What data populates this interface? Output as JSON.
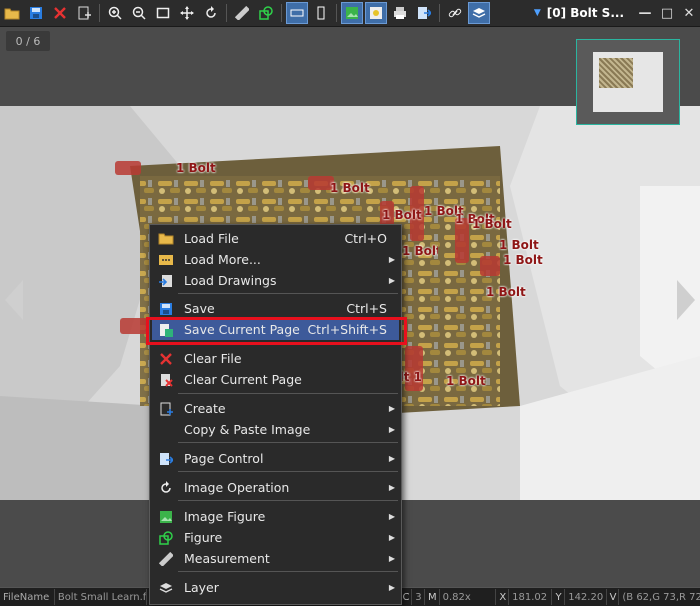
{
  "window": {
    "title": "[0] Bolt S...",
    "controls": [
      "—",
      "□",
      "✕"
    ]
  },
  "viewer": {
    "page_counter": "0 / 6"
  },
  "annotations": [
    {
      "text": "1 Bolt"
    },
    {
      "text": "1 Bolt"
    },
    {
      "text": "1 Bolt"
    },
    {
      "text": "1 Bolt"
    },
    {
      "text": "1 Bolt"
    },
    {
      "text": "1 Bolt"
    },
    {
      "text": "1 Bolt"
    },
    {
      "text": "1 Bolt"
    },
    {
      "text": "1 Bolt"
    },
    {
      "text": "1 Bolt"
    },
    {
      "text": "1 Bolt"
    },
    {
      "text": "1 Bolt"
    }
  ],
  "context_menu": {
    "items": [
      {
        "label": "Load File",
        "shortcut": "Ctrl+O",
        "icon": "folder-icon"
      },
      {
        "label": "Load More...",
        "submenu": true,
        "icon": "load-more-icon"
      },
      {
        "label": "Load Drawings",
        "submenu": true,
        "icon": "load-drawings-icon"
      },
      {
        "label": "Save",
        "shortcut": "Ctrl+S",
        "icon": "save-icon"
      },
      {
        "label": "Save Current Page",
        "shortcut": "Ctrl+Shift+S",
        "icon": "save-page-icon",
        "highlighted": true
      },
      {
        "label": "Clear File",
        "icon": "clear-file-icon"
      },
      {
        "label": "Clear Current Page",
        "icon": "clear-page-icon"
      },
      {
        "label": "Create",
        "submenu": true,
        "icon": "create-icon"
      },
      {
        "label": "Copy & Paste Image",
        "submenu": true
      },
      {
        "label": "Page Control",
        "submenu": true,
        "icon": "page-control-icon"
      },
      {
        "label": "Image Operation",
        "submenu": true,
        "icon": "image-operation-icon"
      },
      {
        "label": "Image Figure",
        "submenu": true,
        "icon": "image-figure-icon"
      },
      {
        "label": "Figure",
        "submenu": true,
        "icon": "figure-icon"
      },
      {
        "label": "Measurement",
        "submenu": true,
        "icon": "measurement-icon"
      },
      {
        "label": "Layer",
        "submenu": true,
        "icon": "layer-icon"
      }
    ]
  },
  "statusbar": {
    "filename_label": "FileName",
    "filename_value": "Bolt Small Learn.f",
    "c_label": "C",
    "c_value": "3",
    "m_label": "M",
    "m_value": "0.82x",
    "x_label": "X",
    "x_value": "181.02",
    "y_label": "Y",
    "y_value": "142.20",
    "v_label": "V",
    "v_value": "(B 62,G 73,R 72)"
  },
  "colors": {
    "annotation": "#8e1515",
    "highlight": "#3d5a9a",
    "callout": "#e8101d",
    "minimap_border": "#2bb5a0"
  }
}
